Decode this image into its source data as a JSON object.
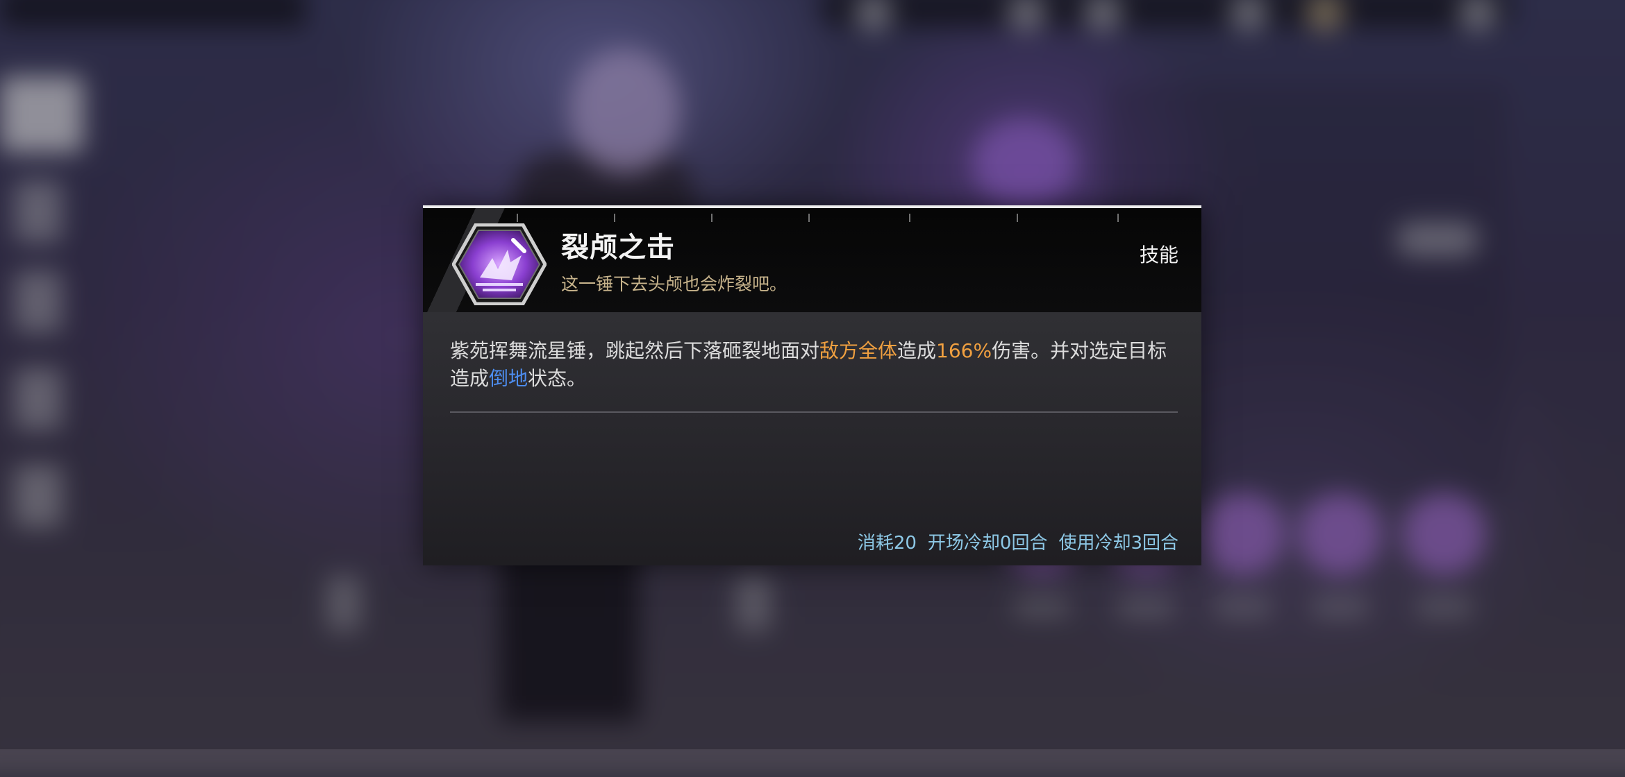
{
  "skill": {
    "title": "裂颅之击",
    "subtitle": "这一锤下去头颅也会炸裂吧。",
    "type_label": "技能",
    "description": {
      "part1": "紫苑挥舞流星锤，跳起然后下落砸裂地面对",
      "target": "敌方全体",
      "part2": "造成",
      "damage": "166%",
      "part3": "伤害。并对选定目标造成",
      "status": "倒地",
      "part4": "状态。"
    },
    "cost": "消耗20",
    "initial_cooldown": "开场冷却0回合",
    "use_cooldown": "使用冷却3回合"
  },
  "colors": {
    "highlight_orange": "#f0a040",
    "highlight_blue": "#4d8df0",
    "cost_text": "#8dc8e6",
    "subtitle": "#c8b48c",
    "icon_purple": "#8a3fd0"
  },
  "icons": {
    "skill_icon": "purple-hexagon-hammer-strike-icon"
  }
}
